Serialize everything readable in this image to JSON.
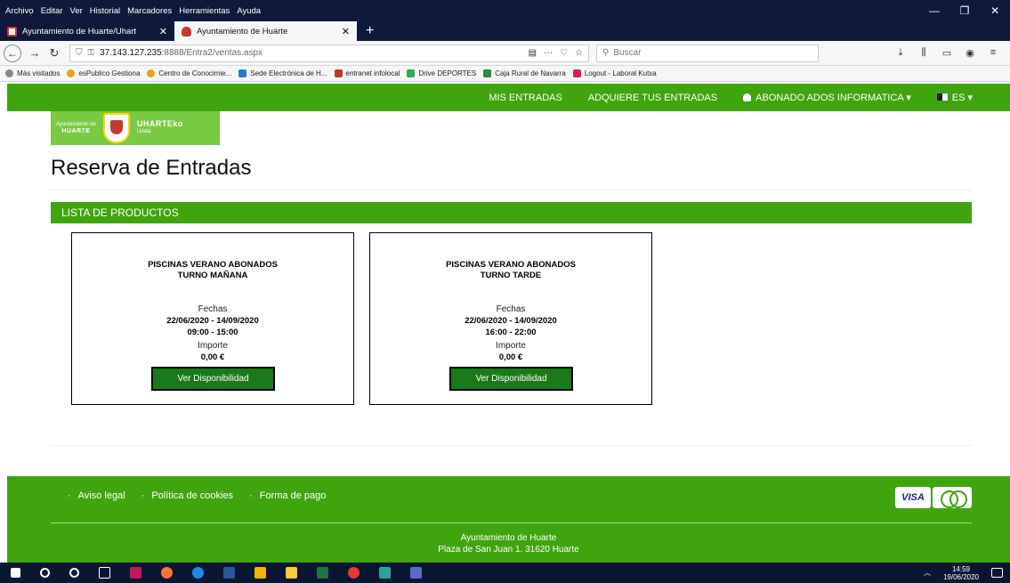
{
  "browser": {
    "menu": [
      "Archivo",
      "Editar",
      "Ver",
      "Historial",
      "Marcadores",
      "Herramientas",
      "Ayuda"
    ],
    "tabs": [
      {
        "label": "Ayuntamiento de Huarte/Uhart",
        "close": "✕"
      },
      {
        "label": "Ayuntamiento de Huarte",
        "close": "✕"
      }
    ],
    "new_tab": "+",
    "url_host": "37.143.127.235",
    "url_path": ":8888/Entra2/ventas.aspx",
    "search_placeholder": "Buscar",
    "bookmarks": [
      {
        "label": "Más visitados",
        "color": "#888888"
      },
      {
        "label": "esPublico Gestiona",
        "color": "#e8a317"
      },
      {
        "label": "Centro de Conocimie...",
        "color": "#e8a317"
      },
      {
        "label": "Sede Electrónica de H...",
        "color": "#2b7bd6"
      },
      {
        "label": "entranet infolocal",
        "color": "#c0392b"
      },
      {
        "label": "Drive DEPORTES",
        "color": "#34a853"
      },
      {
        "label": "Caja Rural de Navarra",
        "color": "#2e8b3a"
      },
      {
        "label": "Logout - Laboral Kutxa",
        "color": "#d81b60"
      }
    ]
  },
  "nav": {
    "mis_entradas": "MIS ENTRADAS",
    "adquiere": "ADQUIERE TUS ENTRADAS",
    "user": "ABONADO ADOS INFORMATICA ▾",
    "lang": "ES ▾"
  },
  "logo": {
    "left_line1": "Ayuntamiento de",
    "left_line2": "HUARTE",
    "right_line1": "UHARTEko",
    "right_line2": "Udala"
  },
  "page": {
    "title": "Reserva de Entradas",
    "list_heading": "LISTA DE PRODUCTOS"
  },
  "products": [
    {
      "title_line1": "PISCINAS VERANO ABONADOS",
      "title_line2": "TURNO MAÑANA",
      "fechas_label": "Fechas",
      "dates": "22/06/2020 - 14/09/2020",
      "hours": "09:00 - 15:00",
      "importe_label": "Importe",
      "price": "0,00 €",
      "button": "Ver Disponibilidad"
    },
    {
      "title_line1": "PISCINAS VERANO ABONADOS",
      "title_line2": "TURNO TARDE",
      "fechas_label": "Fechas",
      "dates": "22/06/2020 - 14/09/2020",
      "hours": "16:00 - 22:00",
      "importe_label": "Importe",
      "price": "0,00 €",
      "button": "Ver Disponibilidad"
    }
  ],
  "footer": {
    "links": [
      "Aviso legal",
      "Política de cookies",
      "Forma de pago"
    ],
    "visa": "VISA",
    "address_line1": "Ayuntamiento de Huarte",
    "address_line2": "Plaza de San Juan 1. 31620 Huarte"
  },
  "taskbar": {
    "time": "14:59",
    "date": "19/06/2020"
  }
}
